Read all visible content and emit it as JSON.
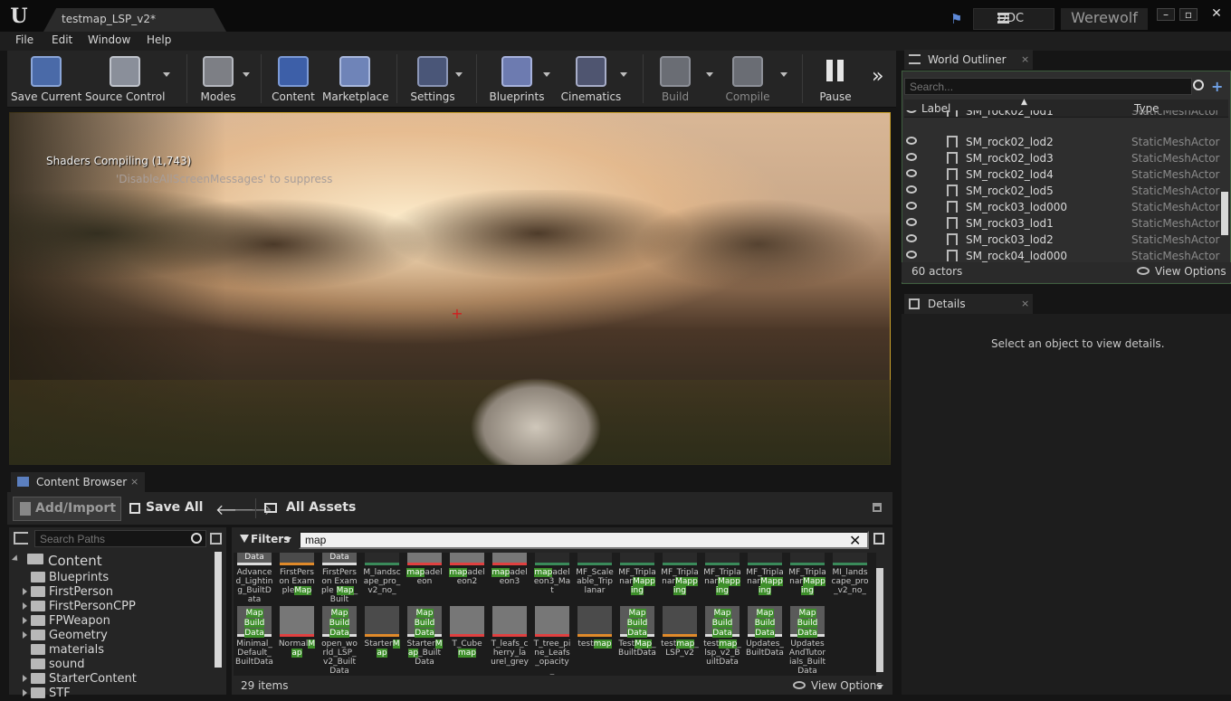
{
  "window": {
    "tab_title": "testmap_LSP_v2*",
    "ddc_label": "DDC",
    "project_name": "Werewolf"
  },
  "menu": [
    "File",
    "Edit",
    "Window",
    "Help"
  ],
  "toolbar": {
    "save_current": "Save Current",
    "source_control": "Source Control",
    "modes": "Modes",
    "content": "Content",
    "marketplace": "Marketplace",
    "settings": "Settings",
    "blueprints": "Blueprints",
    "cinematics": "Cinematics",
    "build": "Build",
    "compile": "Compile",
    "pause": "Pause",
    "overflow": "»"
  },
  "viewport": {
    "shader_message": "Shaders Compiling (1,743)",
    "suppress_message": "'DisableAllScreenMessages' to suppress"
  },
  "world_outliner": {
    "tab": "World Outliner",
    "tab_close": "×",
    "search_placeholder": "Search...",
    "col_label": "Label",
    "col_type": "Type",
    "rows": [
      {
        "label": "SM_rock02_lod1",
        "type": "StaticMeshActor"
      },
      {
        "label": "SM_rock02_lod2",
        "type": "StaticMeshActor"
      },
      {
        "label": "SM_rock02_lod3",
        "type": "StaticMeshActor"
      },
      {
        "label": "SM_rock02_lod4",
        "type": "StaticMeshActor"
      },
      {
        "label": "SM_rock02_lod5",
        "type": "StaticMeshActor"
      },
      {
        "label": "SM_rock03_lod000",
        "type": "StaticMeshActor"
      },
      {
        "label": "SM_rock03_lod1",
        "type": "StaticMeshActor"
      },
      {
        "label": "SM_rock03_lod2",
        "type": "StaticMeshActor"
      },
      {
        "label": "SM_rock04_lod000",
        "type": "StaticMeshActor"
      }
    ],
    "actor_count": "60 actors",
    "view_options": "View Options"
  },
  "details": {
    "tab": "Details",
    "tab_close": "×",
    "empty_message": "Select an object to view details."
  },
  "content_browser": {
    "tab": "Content Browser",
    "tab_close": "×",
    "add_import": "Add/Import",
    "save_all": "Save All",
    "path": "All Assets",
    "path_search_placeholder": "Search Paths",
    "filters": "Filters",
    "filter_text": "map",
    "tree": [
      {
        "name": "Content",
        "arrow": "open",
        "level": 0
      },
      {
        "name": "Blueprints",
        "arrow": "",
        "level": 1
      },
      {
        "name": "FirstPerson",
        "arrow": "closed",
        "level": 1
      },
      {
        "name": "FirstPersonCPP",
        "arrow": "closed",
        "level": 1
      },
      {
        "name": "FPWeapon",
        "arrow": "closed",
        "level": 1
      },
      {
        "name": "Geometry",
        "arrow": "closed",
        "level": 1
      },
      {
        "name": "materials",
        "arrow": "",
        "level": 1
      },
      {
        "name": "sound",
        "arrow": "",
        "level": 1
      },
      {
        "name": "StarterContent",
        "arrow": "closed",
        "level": 1
      },
      {
        "name": "STF",
        "arrow": "closed",
        "level": 1
      }
    ],
    "assets_row1": [
      {
        "pre": "Advanced_Lighting_BuiltData",
        "hl": "",
        "post": "",
        "kind": "bd",
        "thumb": "Data"
      },
      {
        "pre": "FirstPerson Example",
        "hl": "Map",
        "post": "",
        "kind": "map",
        "thumb": ""
      },
      {
        "pre": "FirstPerson Example ",
        "hl": "Map",
        "post": "_Built",
        "kind": "bd",
        "thumb": "Data"
      },
      {
        "pre": "M_landscape_pro_v2_no_",
        "hl": "",
        "post": "",
        "kind": "mf",
        "thumb": ""
      },
      {
        "pre": "",
        "hl": "map",
        "post": "adeleon",
        "kind": "tx",
        "thumb": ""
      },
      {
        "pre": "",
        "hl": "map",
        "post": "adeleon2",
        "kind": "tx",
        "thumb": ""
      },
      {
        "pre": "",
        "hl": "map",
        "post": "adeleon3",
        "kind": "tx",
        "thumb": ""
      },
      {
        "pre": "",
        "hl": "map",
        "post": "adeleon3_Mat",
        "kind": "mf",
        "thumb": ""
      },
      {
        "pre": "MF_Scaleable_Triplanar",
        "hl": "",
        "post": "",
        "kind": "mf",
        "thumb": ""
      },
      {
        "pre": "MF_Triplanar",
        "hl": "Mapping",
        "post": "",
        "kind": "mf",
        "thumb": ""
      },
      {
        "pre": "MF_Triplanar",
        "hl": "Mapping",
        "post": "",
        "kind": "mf",
        "thumb": ""
      },
      {
        "pre": "MF_Triplanar",
        "hl": "Mapping",
        "post": "",
        "kind": "mf",
        "thumb": ""
      },
      {
        "pre": "MF_Triplanar",
        "hl": "Mapping",
        "post": "",
        "kind": "mf",
        "thumb": ""
      },
      {
        "pre": "MF_Triplanar",
        "hl": "Mapping",
        "post": "",
        "kind": "mf",
        "thumb": ""
      },
      {
        "pre": "MI_landscape_pro_v2_no_",
        "hl": "",
        "post": "",
        "kind": "mf",
        "thumb": ""
      }
    ],
    "assets_row2": [
      {
        "pre": "Minimal_Default_BuiltData",
        "hl": "",
        "post": "",
        "kind": "bd",
        "thumb": "Map Build Data"
      },
      {
        "pre": "Normal",
        "hl": "Map",
        "post": "",
        "kind": "tx",
        "thumb": ""
      },
      {
        "pre": "open_world_LSP_v2_BuiltData",
        "hl": "",
        "post": "",
        "kind": "bd",
        "thumb": "Map Build Data"
      },
      {
        "pre": "Starter",
        "hl": "Map",
        "post": "",
        "kind": "map",
        "thumb": ""
      },
      {
        "pre": "Starter",
        "hl": "Map",
        "post": "_BuiltData",
        "kind": "bd",
        "thumb": "Map Build Data"
      },
      {
        "pre": "T_Cube",
        "hl": "map",
        "post": "",
        "kind": "tx",
        "thumb": ""
      },
      {
        "pre": "T_leafs_cherry_laurel_grey",
        "hl": "",
        "post": "",
        "kind": "tx",
        "thumb": ""
      },
      {
        "pre": "T_tree_pine_Leafs_opacity_",
        "hl": "",
        "post": "",
        "kind": "tx",
        "thumb": ""
      },
      {
        "pre": "test",
        "hl": "map",
        "post": "",
        "kind": "map",
        "thumb": ""
      },
      {
        "pre": "Test",
        "hl": "Map",
        "post": "_BuiltData",
        "kind": "bd",
        "thumb": "Map Build Data"
      },
      {
        "pre": "test",
        "hl": "map",
        "post": "_LSP_v2",
        "kind": "map",
        "thumb": ""
      },
      {
        "pre": "test",
        "hl": "map",
        "post": "_lsp_v2_BuiltData",
        "kind": "bd",
        "thumb": "Map Build Data"
      },
      {
        "pre": "Updates_BuiltData",
        "hl": "",
        "post": "",
        "kind": "bd",
        "thumb": "Map Build Data"
      },
      {
        "pre": "UpdatesAndTutorials_BuiltData",
        "hl": "",
        "post": "",
        "kind": "bd",
        "thumb": "Map Build Data"
      }
    ],
    "item_count": "29 items",
    "view_options": "View Options"
  },
  "colors": {
    "accent_green": "#3d8f2a",
    "viewport_border": "#c9a02a",
    "map_orange": "#e08a2a"
  }
}
